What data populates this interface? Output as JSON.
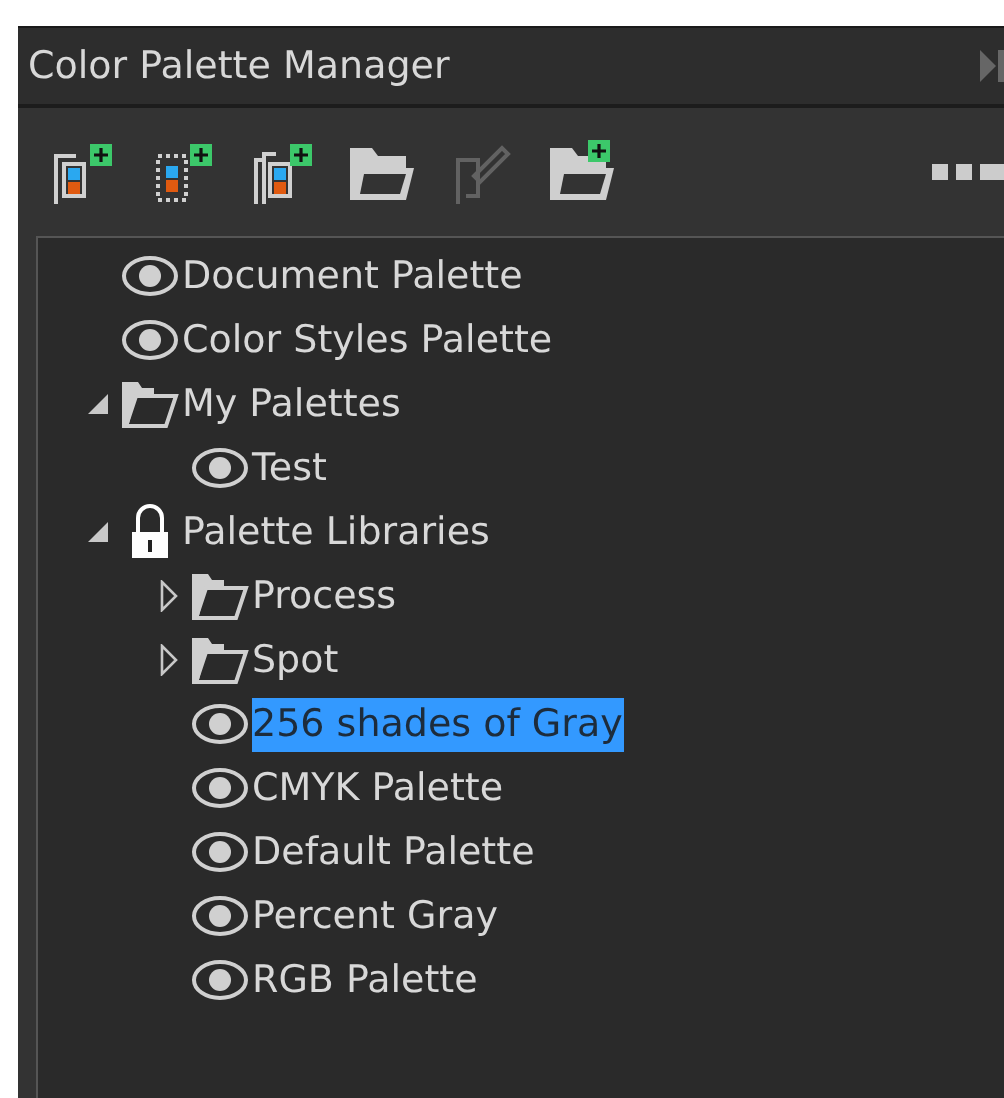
{
  "panel": {
    "title": "Color Palette Manager"
  },
  "toolbar": [
    {
      "kind": "new-palette",
      "disabled": false
    },
    {
      "kind": "palette-from-selection",
      "disabled": false
    },
    {
      "kind": "palette-from-document",
      "disabled": false
    },
    {
      "kind": "open",
      "disabled": false
    },
    {
      "kind": "edit",
      "disabled": true
    },
    {
      "kind": "new-folder",
      "disabled": false
    }
  ],
  "tree": [
    {
      "label": "Document Palette",
      "kind": "palette",
      "selected": false
    },
    {
      "label": "Color Styles Palette",
      "kind": "palette",
      "selected": false
    },
    {
      "label": "My Palettes",
      "kind": "folder",
      "expanded": true,
      "selected": false,
      "children": [
        {
          "label": "Test",
          "kind": "palette",
          "selected": false
        }
      ]
    },
    {
      "label": "Palette Libraries",
      "kind": "library",
      "expanded": true,
      "selected": false,
      "children": [
        {
          "label": "Process",
          "kind": "folder",
          "expanded": false,
          "selected": false
        },
        {
          "label": "Spot",
          "kind": "folder",
          "expanded": false,
          "selected": false
        },
        {
          "label": "256 shades of Gray",
          "kind": "palette",
          "selected": true
        },
        {
          "label": "CMYK Palette",
          "kind": "palette",
          "selected": false
        },
        {
          "label": "Default Palette",
          "kind": "palette",
          "selected": false
        },
        {
          "label": "Percent Gray",
          "kind": "palette",
          "selected": false
        },
        {
          "label": "RGB Palette",
          "kind": "palette",
          "selected": false
        }
      ]
    }
  ]
}
